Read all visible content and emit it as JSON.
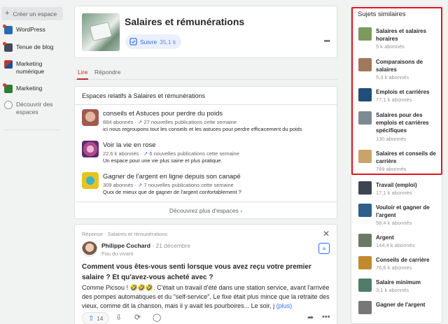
{
  "sidebar": {
    "create_space": "Créer un espace",
    "items": [
      {
        "label": "WordPress",
        "color": "#2a6ab0",
        "dot": true
      },
      {
        "label": "Tenue de blog",
        "color": "#444a5a",
        "dot": true
      },
      {
        "label": "Marketing numérique",
        "color": "#c0392b",
        "dot": false
      },
      {
        "label": "Marketing",
        "color": "#2e7d32",
        "dot": true
      },
      {
        "label": "Découvrir des espaces",
        "icon": "compass-icon"
      }
    ]
  },
  "topic": {
    "title": "Salaires et rémunérations",
    "follow_label": "Suivre",
    "follow_count": "35,1 k"
  },
  "tabs": {
    "read": "Lire",
    "answer": "Répondre"
  },
  "spaces": {
    "heading": "Espaces relatifs à Salaires et rémunérations",
    "items": [
      {
        "name": "conseils et Astuces pour perdre du poids",
        "followers": "884 abonnés",
        "posts": "27 nouvelles publications cette semaine",
        "desc": "ici nous regroupons tout les conseils et les astuces pour perdre efficacement du poids",
        "color": "#a15a52"
      },
      {
        "name": "Voir la vie en rose",
        "followers": "22,6 k abonnés",
        "posts": "6 nouvelles publications cette semaine",
        "desc": "Un espace pour une vie plus saine et plus pratique.",
        "color": "#b04a8c"
      },
      {
        "name": "Gagner de l'argent en ligne depuis son canapé",
        "followers": "309 abonnés",
        "posts": "7 nouvelles publications cette semaine",
        "desc": "Quoi de mieux que de gagner de l'argent confortablement ?",
        "color": "#e8c21e"
      }
    ],
    "discover": "Découvrez plus d'espaces"
  },
  "answer": {
    "context": "Réponse · Salaires et rémunérations",
    "author": "Philippe Cochard",
    "date": "· 21 décembre",
    "credential": "Fou du vivant",
    "question": "Comment vous êtes-vous senti lorsque vous avez reçu votre premier salaire ? Et qu'avez-vous acheté avec ?",
    "text": "Comme Picsou ! 🤣🤣🤣. C'était un travail d'été dans une station service, avant l'arrivée des pompes automatiques et du \"self-service\". Le fixe était plus mince que la retraite des vieux, comme dit la chanson, mais il y avait les pourboires... Le soir, j",
    "more": "(plus)",
    "upvotes": "14"
  },
  "related": {
    "heading": "Sujets similaires",
    "items": [
      {
        "name": "Salaires et salaires horaires",
        "count": "5 k abonnés",
        "color": "#7c9a5c"
      },
      {
        "name": "Comparaisons de salaires",
        "count": "5,3 k abonnés",
        "color": "#a0785a"
      },
      {
        "name": "Emplois et carrières",
        "count": "77,1 k abonnés",
        "color": "#1f4e79"
      },
      {
        "name": "Salaires pour des emplois et carrières spécifiques",
        "count": "130 abonnés",
        "color": "#7d8a96"
      },
      {
        "name": "Salaires et conseils de carrière",
        "count": "789 abonnés",
        "color": "#c9a46a"
      },
      {
        "name": "Travail (emploi)",
        "count": "17,1 k abonnés",
        "color": "#3d4650"
      },
      {
        "name": "Vouloir et gagner de l'argent",
        "count": "58,4 k abonnés",
        "color": "#2f5f8a"
      },
      {
        "name": "Argent",
        "count": "144,4 k abonnés",
        "color": "#6b7a65"
      },
      {
        "name": "Conseils de carrière",
        "count": "76,6 k abonnés",
        "color": "#c28a2e"
      },
      {
        "name": "Salaire minimum",
        "count": "3,1 k abonnés",
        "color": "#4f7d6a"
      },
      {
        "name": "Gagner de l'argent",
        "count": "",
        "color": "#777777"
      }
    ]
  },
  "colors": {
    "accent": "#2e69ff",
    "brand": "#b92b27",
    "highlight": "#e3131c"
  }
}
